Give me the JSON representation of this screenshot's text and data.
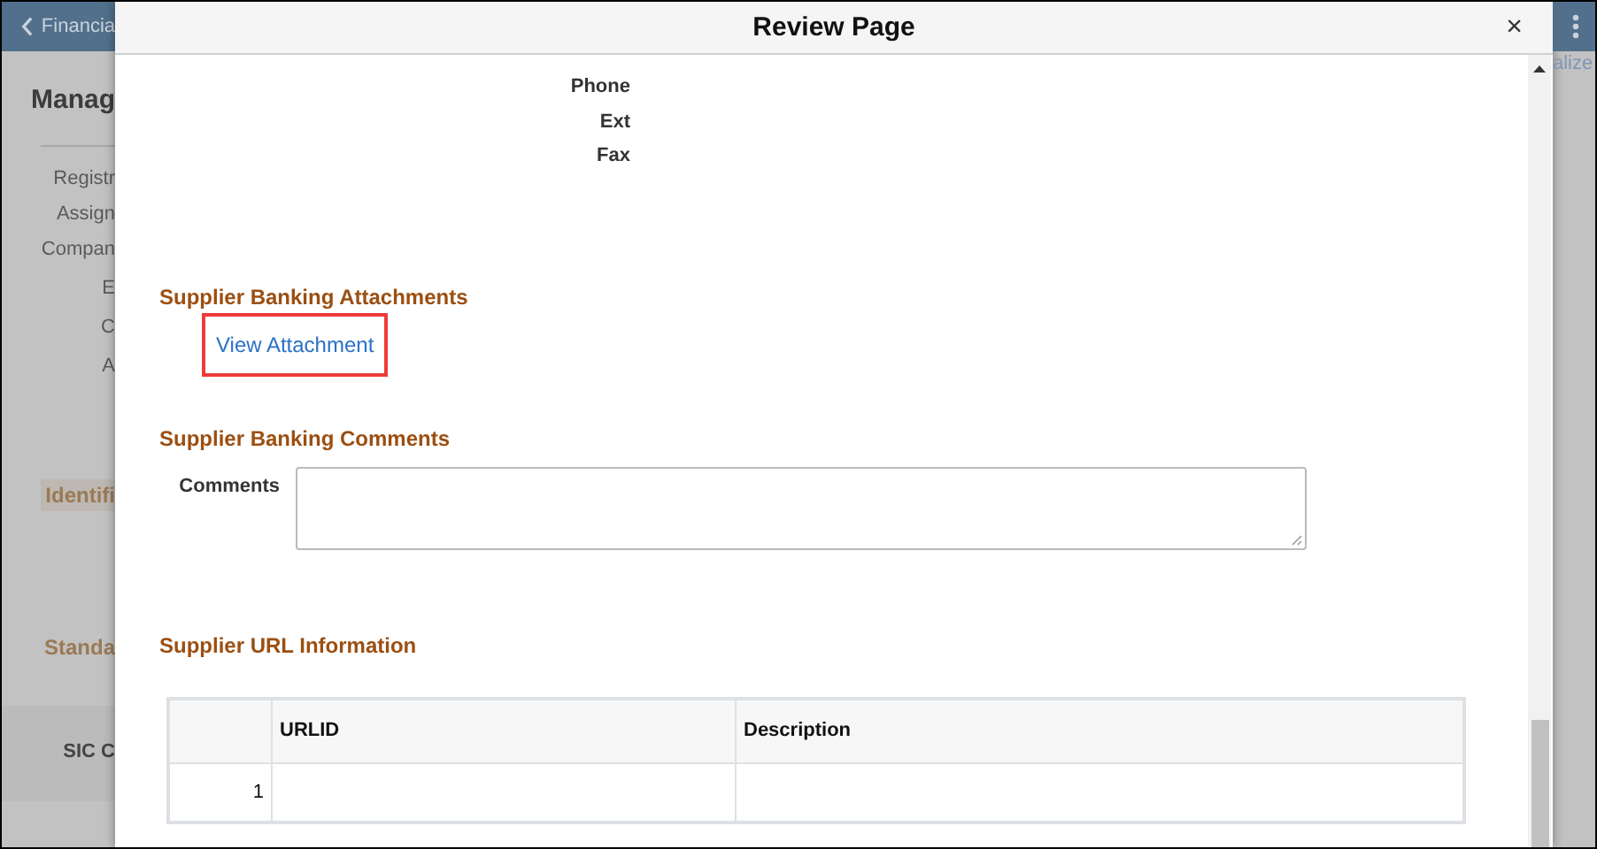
{
  "background_page": {
    "back_link": "Financia",
    "title": "Manag",
    "nav_items": [
      "Registr",
      "Assign",
      "Compan"
    ],
    "sub_items": [
      "E",
      "C",
      "A"
    ],
    "section_labels": [
      "Identifi",
      "Standa"
    ],
    "table_header": "SIC C",
    "action_link": "alize"
  },
  "dialog": {
    "title": "Review Page",
    "close": "×",
    "contact_fields": [
      "Phone",
      "Ext",
      "Fax"
    ],
    "attachments": {
      "heading": "Supplier Banking Attachments",
      "link": "View Attachment"
    },
    "comments": {
      "heading": "Supplier Banking Comments",
      "label": "Comments"
    },
    "url_info": {
      "heading": "Supplier URL Information",
      "columns": [
        "URLID",
        "Description"
      ],
      "rows": [
        {
          "number": "1"
        }
      ]
    }
  }
}
